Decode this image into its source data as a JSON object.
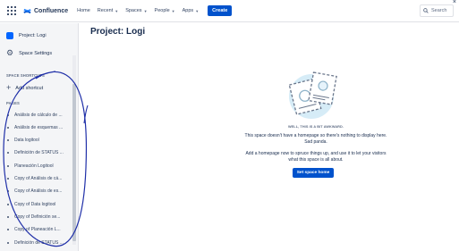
{
  "topnav": {
    "product": "Confluence",
    "items": [
      {
        "label": "Home",
        "has_caret": false
      },
      {
        "label": "Recent",
        "has_caret": true
      },
      {
        "label": "Spaces",
        "has_caret": true
      },
      {
        "label": "People",
        "has_caret": true
      },
      {
        "label": "Apps",
        "has_caret": true
      }
    ],
    "create_label": "Create",
    "search_label": "Search"
  },
  "sidebar": {
    "space_name": "Project: Logi",
    "space_settings": "Space Settings",
    "shortcuts_header": "SPACE SHORTCUTS",
    "add_shortcut": "Add shortcut",
    "pages_header": "PAGES",
    "pages": [
      "Análisis de cálculo de ...",
      "Análisis de esquemas ...",
      "Data logitool",
      "Definición de STATUS ...",
      "Planeación Logitool",
      "Copy of Análisis de cá...",
      "Copy of Análisis de es...",
      "Copy of Data logitool",
      "Copy of Definición se...",
      "Copy of Planeación L...",
      "Definición de STATUS ..."
    ]
  },
  "main": {
    "title": "Project: Logi",
    "empty_heading": "WELL, THIS IS A BIT AWKWARD.",
    "empty_line1": "This space doesn't have a homepage so there's nothing to display here. Sad panda.",
    "empty_line2": "Add a homepage now to spruce things up, and use it to let your visitors what this space is all about.",
    "home_button": "Set space home"
  },
  "colors": {
    "brand": "#0052cc",
    "sidebar_bg": "#f4f5f7",
    "annotation_ink": "#1f2fa8"
  }
}
